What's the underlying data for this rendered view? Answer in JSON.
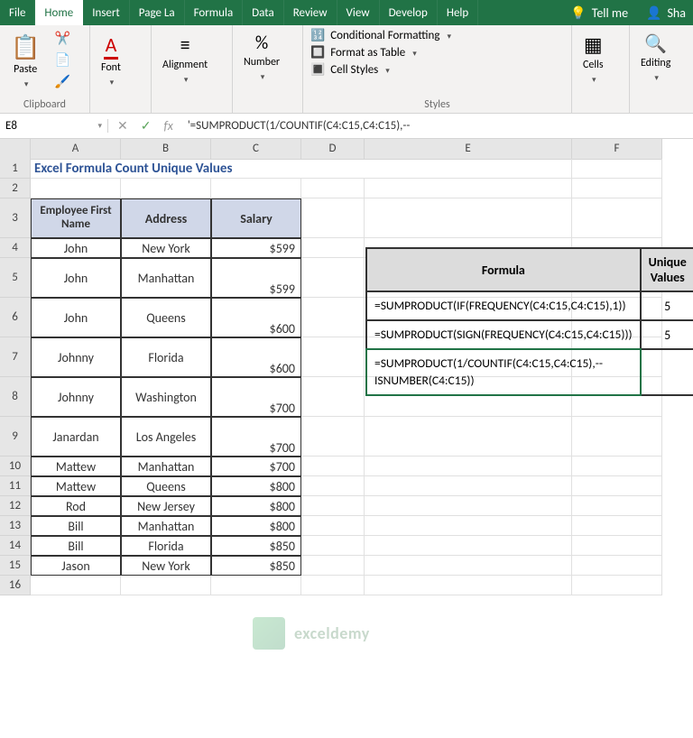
{
  "menu": {
    "file": "File",
    "home": "Home",
    "insert": "Insert",
    "page": "Page La",
    "formula": "Formula",
    "data": "Data",
    "review": "Review",
    "view": "View",
    "develop": "Develop",
    "help": "Help",
    "tellme": "Tell me",
    "share": "Sha"
  },
  "ribbon": {
    "paste": "Paste",
    "font": "Font",
    "alignment": "Alignment",
    "number": "Number",
    "cells": "Cells",
    "editing": "Editing",
    "clipboard": "Clipboard",
    "stylesGroup": "Styles",
    "condfmt": "Conditional Formatting",
    "fmttable": "Format as Table",
    "cellstyles": "Cell Styles"
  },
  "namebox": "E8",
  "formulaBar": "'=SUMPRODUCT(1/COUNTIF(C4:C15,C4:C15),--",
  "cols": [
    "A",
    "B",
    "C",
    "D",
    "E",
    "F"
  ],
  "title": "Excel Formula Count Unique Values",
  "headers": {
    "emp": "Employee First Name",
    "addr": "Address",
    "sal": "Salary"
  },
  "rows": [
    {
      "n": "4",
      "a": "John",
      "b": "New York",
      "c": "$599",
      "h": 1
    },
    {
      "n": "5",
      "a": "John",
      "b": "Manhattan",
      "c": "$599",
      "h": 2
    },
    {
      "n": "6",
      "a": "John",
      "b": "Queens",
      "c": "$600",
      "h": 2
    },
    {
      "n": "7",
      "a": "Johnny",
      "b": "Florida",
      "c": "$600",
      "h": 2
    },
    {
      "n": "8",
      "a": "Johnny",
      "b": "Washington",
      "c": "$700",
      "h": 2
    },
    {
      "n": "9",
      "a": "Janardan",
      "b": "Los Angeles",
      "c": "$700",
      "h": 2
    },
    {
      "n": "10",
      "a": "Mattew",
      "b": "Manhattan",
      "c": "$700",
      "h": 1
    },
    {
      "n": "11",
      "a": "Mattew",
      "b": "Queens",
      "c": "$800",
      "h": 1
    },
    {
      "n": "12",
      "a": "Rod",
      "b": "New Jersey",
      "c": "$800",
      "h": 1
    },
    {
      "n": "13",
      "a": "Bill",
      "b": "Manhattan",
      "c": "$800",
      "h": 1
    },
    {
      "n": "14",
      "a": "Bill",
      "b": "Florida",
      "c": "$850",
      "h": 1
    },
    {
      "n": "15",
      "a": "Jason",
      "b": "New York",
      "c": "$850",
      "h": 1
    }
  ],
  "ftable": {
    "h1": "Formula",
    "h2": "Unique Values",
    "r": [
      {
        "f": "=SUMPRODUCT(IF(FREQUENCY(C4:C15,C4:C15),1))",
        "v": "5"
      },
      {
        "f": "=SUMPRODUCT(SIGN(FREQUENCY(C4:C15,C4:C15)))",
        "v": "5"
      },
      {
        "f": "=SUMPRODUCT(1/COUNTIF(C4:C15,C4:C15),--ISNUMBER(C4:C15))",
        "v": ""
      }
    ]
  },
  "watermark": "exceldemy"
}
